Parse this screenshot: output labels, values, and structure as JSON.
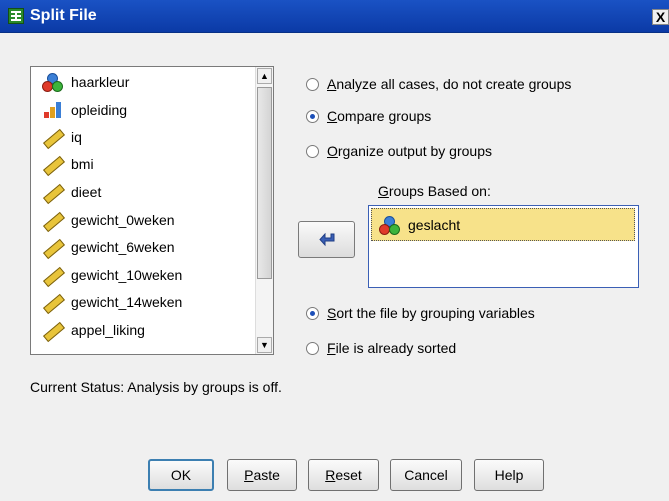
{
  "window": {
    "title": "Split File",
    "close": "X"
  },
  "variables": [
    {
      "name": "haarkleur",
      "icon": "nominal-icon"
    },
    {
      "name": "opleiding",
      "icon": "ordinal-icon"
    },
    {
      "name": "iq",
      "icon": "scale-icon"
    },
    {
      "name": "bmi",
      "icon": "scale-icon"
    },
    {
      "name": "dieet",
      "icon": "scale-icon"
    },
    {
      "name": "gewicht_0weken",
      "icon": "scale-icon"
    },
    {
      "name": "gewicht_6weken",
      "icon": "scale-icon"
    },
    {
      "name": "gewicht_10weken",
      "icon": "scale-icon"
    },
    {
      "name": "gewicht_14weken",
      "icon": "scale-icon"
    },
    {
      "name": "appel_liking",
      "icon": "scale-icon"
    }
  ],
  "group_options": [
    {
      "label_first": "A",
      "label_rest": "nalyze all cases, do not create groups",
      "selected": false
    },
    {
      "label_first": "C",
      "label_rest": "ompare groups",
      "selected": true
    },
    {
      "label_first": "O",
      "label_rest": "rganize output by groups",
      "selected": false
    }
  ],
  "groups_based_on": {
    "label_first": "G",
    "label_rest": "roups Based on:",
    "items": [
      {
        "name": "geslacht",
        "icon": "nominal-icon"
      }
    ]
  },
  "sort_options": [
    {
      "label_first": "S",
      "label_rest": "ort the file by grouping variables",
      "selected": true
    },
    {
      "label_first": "F",
      "label_rest": "ile is already sorted",
      "selected": false
    }
  ],
  "status": "Current Status: Analysis by groups is off.",
  "buttons": {
    "ok": "OK",
    "paste_first": "P",
    "paste_rest": "aste",
    "reset_first": "R",
    "reset_rest": "eset",
    "cancel": "Cancel",
    "help": "Help"
  },
  "colors": {
    "titlebar": "#0b3aa6",
    "selection": "#f7e28a",
    "radio_on": "#1c4fb8"
  }
}
